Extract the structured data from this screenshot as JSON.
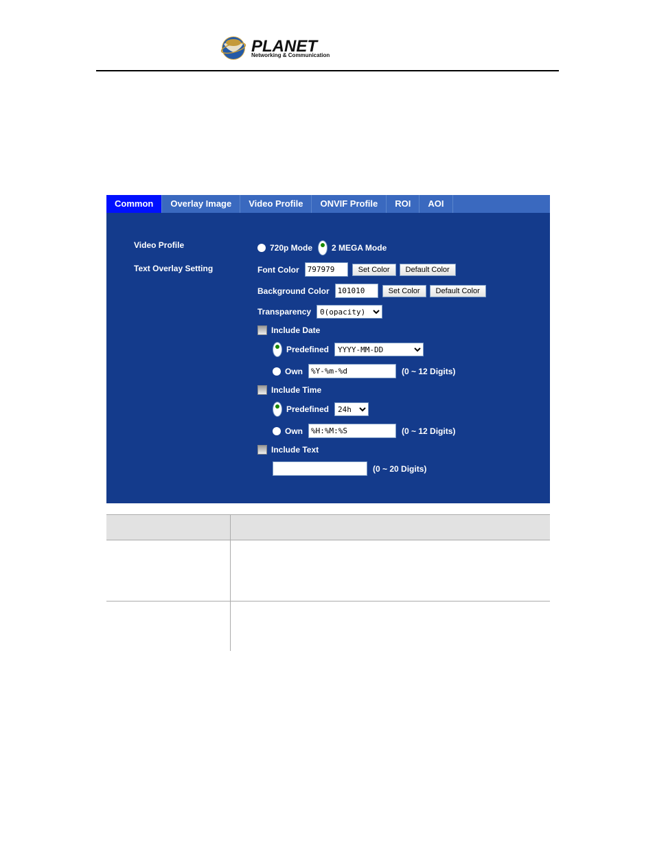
{
  "logo": {
    "main": "PLANET",
    "sub": "Networking & Communication"
  },
  "tabs": [
    "Common",
    "Overlay Image",
    "Video Profile",
    "ONVIF Profile",
    "ROI",
    "AOI"
  ],
  "left_labels": {
    "video_profile": "Video Profile",
    "text_overlay": "Text Overlay Setting"
  },
  "video_mode": {
    "opt1": "720p Mode",
    "opt2": "2 MEGA Mode"
  },
  "font_color": {
    "label": "Font Color",
    "value": "797979",
    "set": "Set Color",
    "default": "Default Color"
  },
  "bg_color": {
    "label": "Background Color",
    "value": "101010",
    "set": "Set Color",
    "default": "Default Color"
  },
  "transparency": {
    "label": "Transparency",
    "value": "0(opacity)"
  },
  "include_date": {
    "label": "Include Date",
    "predefined_label": "Predefined",
    "predefined_value": "YYYY-MM-DD",
    "own_label": "Own",
    "own_value": "%Y-%m-%d",
    "note": "(0 ~ 12 Digits)"
  },
  "include_time": {
    "label": "Include Time",
    "predefined_label": "Predefined",
    "predefined_value": "24h",
    "own_label": "Own",
    "own_value": "%H:%M:%S",
    "note": "(0 ~ 12 Digits)"
  },
  "include_text": {
    "label": "Include Text",
    "value": "",
    "note": "(0 ~ 20 Digits)"
  }
}
